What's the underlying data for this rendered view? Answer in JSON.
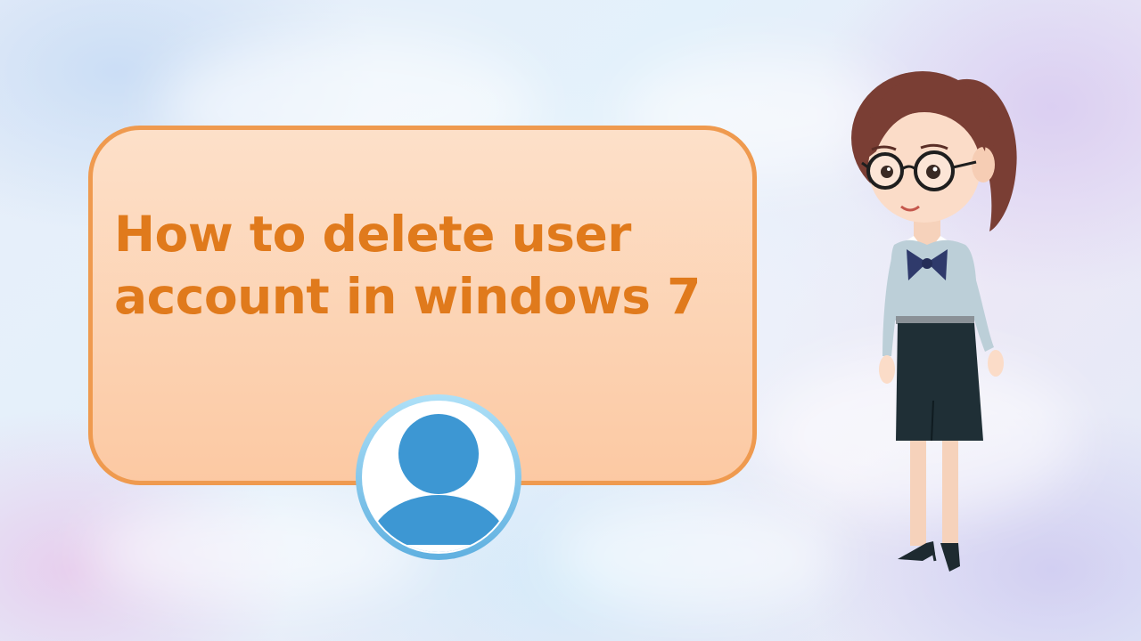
{
  "title": {
    "line1": "How to delete user",
    "line2": "account in windows 7"
  },
  "icons": {
    "avatar": "user-avatar-icon",
    "character": "presenter-character"
  },
  "colors": {
    "title_text": "#e07a1c",
    "card_border": "#ef9a4f",
    "card_fill": "#fcc9a3",
    "avatar_blue": "#3d97d3"
  }
}
